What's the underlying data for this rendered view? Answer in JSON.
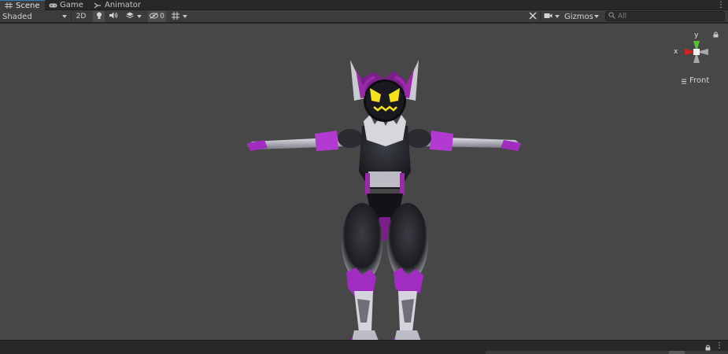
{
  "tabs": [
    {
      "label": "Scene",
      "icon": "grid-icon",
      "active": true
    },
    {
      "label": "Game",
      "icon": "gamepad-icon",
      "active": false
    },
    {
      "label": "Animator",
      "icon": "animator-icon",
      "active": false
    }
  ],
  "toolbar": {
    "shading_mode": "Shaded",
    "mode_2d": "2D",
    "hidden_count": "0",
    "gizmos_label": "Gizmos",
    "search_placeholder": "All"
  },
  "gizmo": {
    "axis_y": "y",
    "axis_x": "x",
    "view_label": "Front"
  },
  "icons": {
    "lighting": "lightbulb-icon",
    "audio": "speaker-icon",
    "effects": "layers-icon",
    "visibility": "eye-slash-icon",
    "grid": "grid-snap-icon",
    "tools": "tools-icon",
    "camera": "camera-icon",
    "search": "search-icon",
    "lock": "lock-icon"
  },
  "colors": {
    "accent_tab": "#3a79bb",
    "viewport_bg": "#474747",
    "gizmo_y": "#58c13a",
    "gizmo_x": "#d12222"
  }
}
